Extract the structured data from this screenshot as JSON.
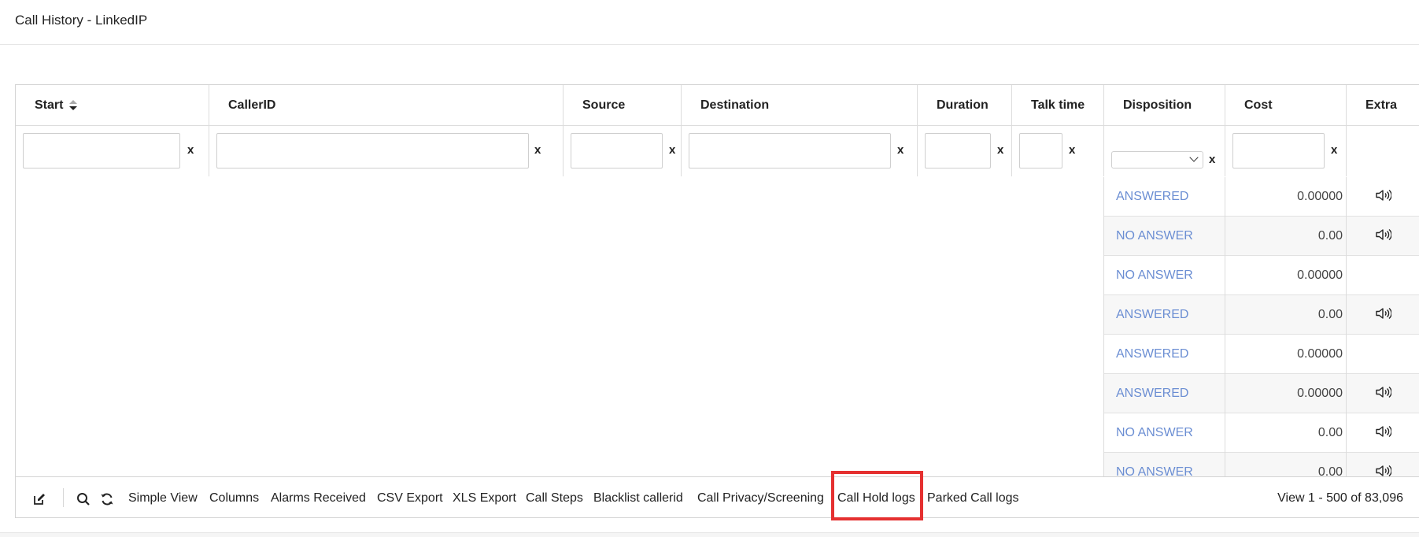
{
  "window": {
    "title": "Call History - LinkedIP"
  },
  "columns": [
    {
      "key": "start",
      "label": "Start"
    },
    {
      "key": "callerid",
      "label": "CallerID"
    },
    {
      "key": "source",
      "label": "Source"
    },
    {
      "key": "destination",
      "label": "Destination"
    },
    {
      "key": "duration",
      "label": "Duration"
    },
    {
      "key": "talk_time",
      "label": "Talk time"
    },
    {
      "key": "disposition",
      "label": "Disposition"
    },
    {
      "key": "cost",
      "label": "Cost"
    },
    {
      "key": "extra",
      "label": "Extra"
    }
  ],
  "filters": {
    "clear_label": "x"
  },
  "rows": [
    {
      "disposition": "ANSWERED",
      "cost": "0.00000",
      "has_recording": true
    },
    {
      "disposition": "NO ANSWER",
      "cost": "0.00",
      "has_recording": true
    },
    {
      "disposition": "NO ANSWER",
      "cost": "0.00000",
      "has_recording": false
    },
    {
      "disposition": "ANSWERED",
      "cost": "0.00",
      "has_recording": true
    },
    {
      "disposition": "ANSWERED",
      "cost": "0.00000",
      "has_recording": false
    },
    {
      "disposition": "ANSWERED",
      "cost": "0.00000",
      "has_recording": true
    },
    {
      "disposition": "NO ANSWER",
      "cost": "0.00",
      "has_recording": true
    },
    {
      "disposition": "NO ANSWER",
      "cost": "0.00",
      "has_recording": true
    }
  ],
  "toolbar": {
    "edit_icon": "edit-icon",
    "search_icon": "search-icon",
    "refresh_icon": "refresh-icon",
    "simple_view": "Simple View",
    "columns": "Columns",
    "alarms_received": "Alarms Received",
    "csv_export": "CSV Export",
    "xls_export": "XLS Export",
    "call_steps": "Call Steps",
    "blacklist_callerid": "Blacklist callerid",
    "call_privacy": "Call Privacy/Screening",
    "call_hold_logs": "Call Hold logs",
    "parked_call_logs": "Parked Call logs"
  },
  "pager": {
    "text": "View 1 - 500 of 83,096"
  },
  "colors": {
    "link": "#6b8ed3",
    "highlight": "#e53030"
  }
}
